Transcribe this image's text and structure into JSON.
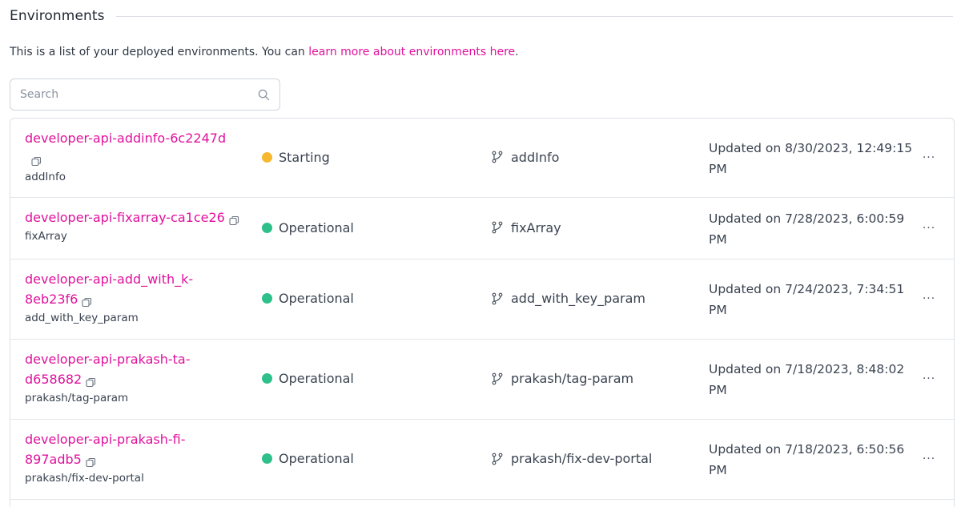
{
  "section": {
    "title": "Environments"
  },
  "intro": {
    "text": "This is a list of your deployed environments. You can ",
    "link": "learn more about environments here",
    "suffix": "."
  },
  "search": {
    "placeholder": "Search",
    "value": ""
  },
  "colors": {
    "accent": "#e0119d",
    "starting": "#f5b82e",
    "operational": "#2ec08a"
  },
  "environments": [
    {
      "name_line1": "developer-api-addinfo-6c2247d",
      "name_line2": "",
      "sub_branch": "addInfo",
      "status": "Starting",
      "status_color": "#f5b82e",
      "branch": "addInfo",
      "updated_line1": "Updated on 8/30/2023, 12:49:15",
      "updated_line2": "PM",
      "menu": "···"
    },
    {
      "name_line1": "developer-api-fixarray-ca1ce26",
      "name_line2": "",
      "sub_branch": "fixArray",
      "status": "Operational",
      "status_color": "#2ec08a",
      "branch": "fixArray",
      "updated_line1": "Updated on 7/28/2023, 6:00:59",
      "updated_line2": "PM",
      "menu": "···"
    },
    {
      "name_line1": "developer-api-add_with_k-",
      "name_line2": "8eb23f6",
      "sub_branch": "add_with_key_param",
      "status": "Operational",
      "status_color": "#2ec08a",
      "branch": "add_with_key_param",
      "updated_line1": "Updated on 7/24/2023, 7:34:51",
      "updated_line2": "PM",
      "menu": "···"
    },
    {
      "name_line1": "developer-api-prakash-ta-",
      "name_line2": "d658682",
      "sub_branch": "prakash/tag-param",
      "status": "Operational",
      "status_color": "#2ec08a",
      "branch": "prakash/tag-param",
      "updated_line1": "Updated on 7/18/2023, 8:48:02",
      "updated_line2": "PM",
      "menu": "···"
    },
    {
      "name_line1": "developer-api-prakash-fi-",
      "name_line2": "897adb5",
      "sub_branch": "prakash/fix-dev-portal",
      "status": "Operational",
      "status_color": "#2ec08a",
      "branch": "prakash/fix-dev-portal",
      "updated_line1": "Updated on 7/18/2023, 6:50:56",
      "updated_line2": "PM",
      "menu": "···"
    }
  ]
}
